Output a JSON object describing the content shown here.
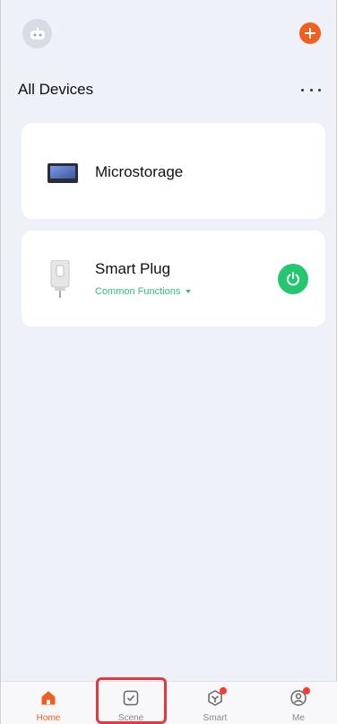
{
  "header": {
    "title": "All Devices"
  },
  "devices": [
    {
      "name": "Microstorage",
      "icon": "tablet-device-icon"
    },
    {
      "name": "Smart Plug",
      "icon": "smart-plug-icon",
      "sub_link": "Common Functions",
      "power_state": "on"
    }
  ],
  "bottom_nav": {
    "items": [
      {
        "label": "Home",
        "icon": "home-icon",
        "active": true
      },
      {
        "label": "Scene",
        "icon": "checkbox-icon",
        "active": false,
        "highlighted": true
      },
      {
        "label": "Smart",
        "icon": "smart-cube-icon",
        "active": false,
        "badge": true
      },
      {
        "label": "Me",
        "icon": "person-icon",
        "active": false,
        "badge": true
      }
    ]
  },
  "colors": {
    "accent": "#f25e1d",
    "power_on": "#24c672",
    "link_green": "#2fbf7a",
    "badge_red": "#ff3b30",
    "highlight_red": "#e3393a"
  }
}
